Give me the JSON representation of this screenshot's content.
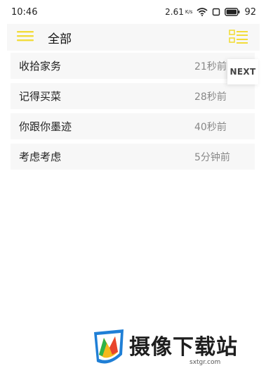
{
  "status_bar": {
    "time": "10:46",
    "net_speed": "2.61",
    "net_unit": "K/s",
    "battery": "92",
    "icons": [
      "wifi-icon",
      "sim-icon",
      "battery-icon"
    ]
  },
  "app_bar": {
    "title": "全部",
    "menu_icon": "hamburger-menu-icon",
    "toggle_icon": "list-view-icon",
    "accent_color": "#f2dc3a"
  },
  "tasks": [
    {
      "title": "收拾家务",
      "time": "21秒前"
    },
    {
      "title": "记得买菜",
      "time": "28秒前"
    },
    {
      "title": "你跟你墨迹",
      "time": "40秒前"
    },
    {
      "title": "考虑考虑",
      "time": "5分钟前"
    }
  ],
  "next_button": {
    "label": "NEXT"
  },
  "watermark": {
    "text": "摄像下载站",
    "url": "sxtgr.com",
    "logo_icon": "watermark-shield-logo"
  }
}
